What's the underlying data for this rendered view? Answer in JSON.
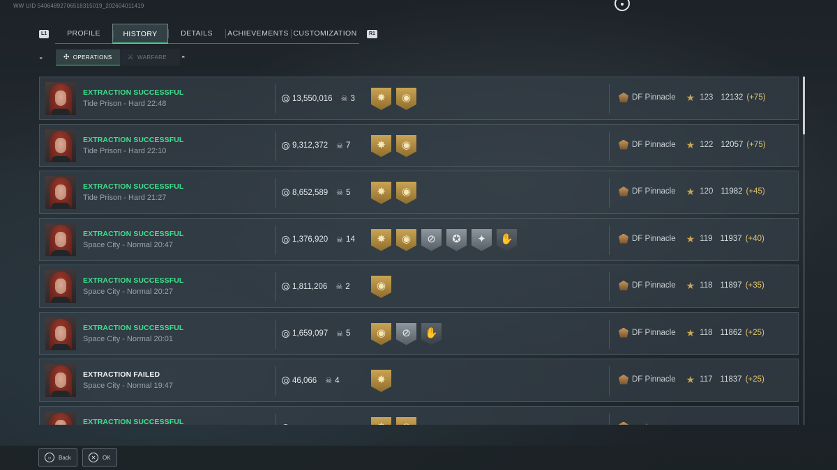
{
  "uid": "WW UID 54064892706518315019_202604011419",
  "nav": {
    "left_bumper": "L1",
    "right_bumper": "R1",
    "tabs": [
      {
        "label": "PROFILE"
      },
      {
        "label": "HISTORY"
      },
      {
        "label": "DETAILS"
      },
      {
        "label": "ACHIEVEMENTS"
      },
      {
        "label": "CUSTOMIZATION"
      }
    ],
    "active_tab": "HISTORY"
  },
  "subnav": {
    "tabs": [
      {
        "label": "OPERATIONS",
        "icon": "operations-icon"
      },
      {
        "label": "WARFARE",
        "icon": "warfare-icon"
      }
    ],
    "active": "OPERATIONS"
  },
  "matches": [
    {
      "status": "EXTRACTION SUCCESSFUL",
      "outcome": "success",
      "map": "Tide Prison - Hard 22:48",
      "value": "13,550,016",
      "kills": "3",
      "badges": [
        "gold-sun",
        "gold-target"
      ],
      "rank": "DF Pinnacle",
      "level": "123",
      "score": "12132",
      "delta": "(+75)"
    },
    {
      "status": "EXTRACTION SUCCESSFUL",
      "outcome": "success",
      "map": "Tide Prison - Hard 22:10",
      "value": "9,312,372",
      "kills": "7",
      "badges": [
        "gold-sun",
        "gold-target"
      ],
      "rank": "DF Pinnacle",
      "level": "122",
      "score": "12057",
      "delta": "(+75)"
    },
    {
      "status": "EXTRACTION SUCCESSFUL",
      "outcome": "success",
      "map": "Tide Prison - Hard 21:27",
      "value": "8,652,589",
      "kills": "5",
      "badges": [
        "gold-sun",
        "gold-target"
      ],
      "rank": "DF Pinnacle",
      "level": "120",
      "score": "11982",
      "delta": "(+45)"
    },
    {
      "status": "EXTRACTION SUCCESSFUL",
      "outcome": "success",
      "map": "Space City - Normal 20:47",
      "value": "1,376,920",
      "kills": "14",
      "badges": [
        "gold-sun",
        "gold-target",
        "silver-crosshair",
        "silver-wings",
        "silver-star",
        "dark-hand"
      ],
      "rank": "DF Pinnacle",
      "level": "119",
      "score": "11937",
      "delta": "(+40)"
    },
    {
      "status": "EXTRACTION SUCCESSFUL",
      "outcome": "success",
      "map": "Space City - Normal 20:27",
      "value": "1,811,206",
      "kills": "2",
      "badges": [
        "gold-target"
      ],
      "rank": "DF Pinnacle",
      "level": "118",
      "score": "11897",
      "delta": "(+35)"
    },
    {
      "status": "EXTRACTION SUCCESSFUL",
      "outcome": "success",
      "map": "Space City - Normal 20:01",
      "value": "1,659,097",
      "kills": "5",
      "badges": [
        "gold-target",
        "silver-crosshair",
        "dark-hand"
      ],
      "rank": "DF Pinnacle",
      "level": "118",
      "score": "11862",
      "delta": "(+25)"
    },
    {
      "status": "EXTRACTION FAILED",
      "outcome": "failed",
      "map": "Space City - Normal 19:47",
      "value": "46,066",
      "kills": "4",
      "badges": [
        "gold-sun"
      ],
      "rank": "DF Pinnacle",
      "level": "117",
      "score": "11837",
      "delta": "(+25)"
    },
    {
      "status": "EXTRACTION SUCCESSFUL",
      "outcome": "success",
      "map": "",
      "value": "",
      "kills": "",
      "badges": [
        "gold-sun",
        "gold-target"
      ],
      "rank": "",
      "level": "",
      "score": "",
      "delta": ""
    }
  ],
  "footer": {
    "back_label": "Back",
    "ok_label": "OK"
  },
  "colors": {
    "accent_green": "#37d68a",
    "success_text": "#3fe08e",
    "delta_gold": "#e0c36a"
  }
}
